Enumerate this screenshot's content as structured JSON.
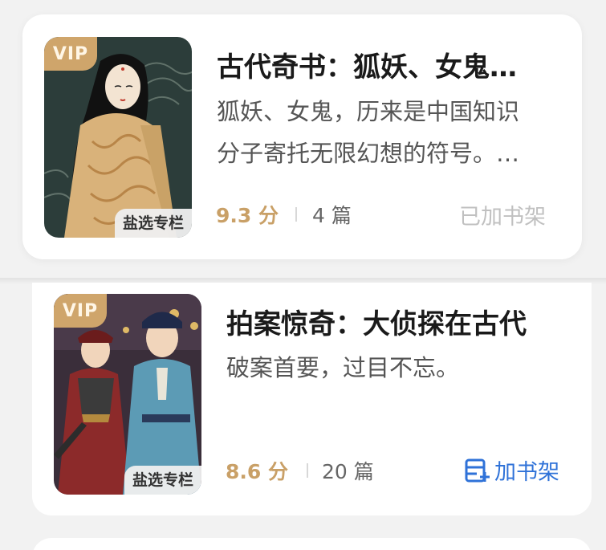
{
  "items": [
    {
      "vip": "VIP",
      "tag": "盐选专栏",
      "title": "古代奇书：狐妖、女鬼…",
      "desc_line1": "狐妖、女鬼，历来是中国知识",
      "desc_line2": "分子寄托无限幻想的符号。…",
      "score": "9.3 分",
      "count": "4 篇",
      "shelf_label": "已加书架"
    },
    {
      "vip": "VIP",
      "tag": "盐选专栏",
      "title": "拍案惊奇：大侦探在古代",
      "desc_line1": "破案首要，过目不忘。",
      "score": "8.6 分",
      "count": "20 篇",
      "shelf_label": "加书架",
      "shelf_icon": "add-shelf-icon"
    }
  ],
  "colors": {
    "accent_gold": "#c9a067",
    "link_blue": "#2f72d8",
    "vip_badge": "#cfa56b"
  }
}
